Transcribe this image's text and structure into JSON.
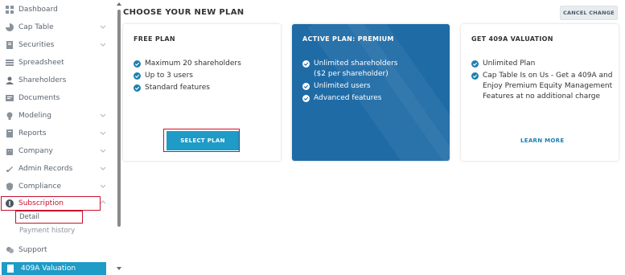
{
  "sidebar": {
    "items": [
      {
        "label": "Dashboard",
        "icon": "dashboard-icon",
        "has_chevron": false
      },
      {
        "label": "Cap Table",
        "icon": "pie-chart-icon",
        "has_chevron": true
      },
      {
        "label": "Securities",
        "icon": "certificate-icon",
        "has_chevron": true
      },
      {
        "label": "Spreadsheet",
        "icon": "table-icon",
        "has_chevron": false
      },
      {
        "label": "Shareholders",
        "icon": "user-icon",
        "has_chevron": false
      },
      {
        "label": "Documents",
        "icon": "document-icon",
        "has_chevron": false
      },
      {
        "label": "Modeling",
        "icon": "lightbulb-icon",
        "has_chevron": true
      },
      {
        "label": "Reports",
        "icon": "report-icon",
        "has_chevron": true
      },
      {
        "label": "Company",
        "icon": "building-icon",
        "has_chevron": true
      },
      {
        "label": "Admin Records",
        "icon": "admin-icon",
        "has_chevron": true
      },
      {
        "label": "Compliance",
        "icon": "shield-icon",
        "has_chevron": true
      },
      {
        "label": "Subscription",
        "icon": "dollar-icon",
        "has_chevron": true
      }
    ],
    "subscription_subitems": [
      {
        "label": "Detail"
      },
      {
        "label": "Payment history"
      }
    ],
    "support_label": "Support",
    "valuation_label": "409A Valuation"
  },
  "header": {
    "title": "CHOOSE YOUR NEW PLAN",
    "cancel_label": "CANCEL CHANGE"
  },
  "plans": {
    "free": {
      "title": "FREE PLAN",
      "features": [
        "Maximum 20 shareholders",
        "Up to 3 users",
        "Standard features"
      ],
      "button_label": "SELECT PLAN"
    },
    "active": {
      "title": "ACTIVE PLAN: PREMIUM",
      "features": [
        "Unlimited shareholders",
        "($2 per shareholder)",
        "Unlimited users",
        "Advanced features"
      ]
    },
    "valuation": {
      "title": "GET 409A VALUATION",
      "features": [
        "Unlimited Plan",
        "Cap Table Is on Us - Get a 409A and",
        "Enjoy Premium Equity Management",
        "Features at no additional charge"
      ],
      "link_label": "LEARN MORE"
    }
  },
  "colors": {
    "accent": "#1e9bc7",
    "active_card": "#1f6ba6",
    "highlight": "#c8102e",
    "check_blue": "#1e7fb0"
  }
}
